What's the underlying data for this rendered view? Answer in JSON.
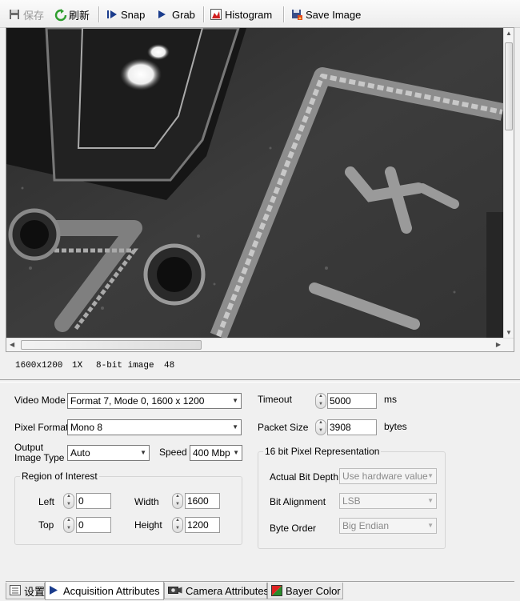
{
  "toolbar": {
    "save_label": "保存",
    "refresh_label": "刷新",
    "snap_label": "Snap",
    "grab_label": "Grab",
    "histogram_label": "Histogram",
    "save_image_label": "Save Image"
  },
  "status": {
    "resolution": "1600x1200",
    "zoom": "1X",
    "depth": "8-bit image",
    "value": "48"
  },
  "settings": {
    "video_mode_label": "Video Mode",
    "video_mode_value": "Format 7, Mode 0, 1600 x 1200",
    "pixel_format_label": "Pixel Format",
    "pixel_format_value": "Mono 8",
    "output_type_label_1": "Output",
    "output_type_label_2": "Image Type",
    "output_type_value": "Auto",
    "speed_label": "Speed",
    "speed_value": "400 Mbp",
    "timeout_label": "Timeout",
    "timeout_value": "5000",
    "timeout_unit": "ms",
    "packet_size_label": "Packet Size",
    "packet_size_value": "3908",
    "packet_size_unit": "bytes",
    "roi": {
      "title": "Region of Interest",
      "left_label": "Left",
      "left_value": "0",
      "top_label": "Top",
      "top_value": "0",
      "width_label": "Width",
      "width_value": "1600",
      "height_label": "Height",
      "height_value": "1200"
    },
    "pixel16": {
      "title": "16 bit Pixel Representation",
      "bit_depth_label": "Actual Bit Depth",
      "bit_depth_value": "Use hardware value",
      "alignment_label": "Bit Alignment",
      "alignment_value": "LSB",
      "byte_order_label": "Byte Order",
      "byte_order_value": "Big Endian"
    }
  },
  "tabs": {
    "settings_label": "设置",
    "acquisition_label": "Acquisition Attributes",
    "camera_label": "Camera Attributes",
    "bayer_label": "Bayer Color"
  }
}
